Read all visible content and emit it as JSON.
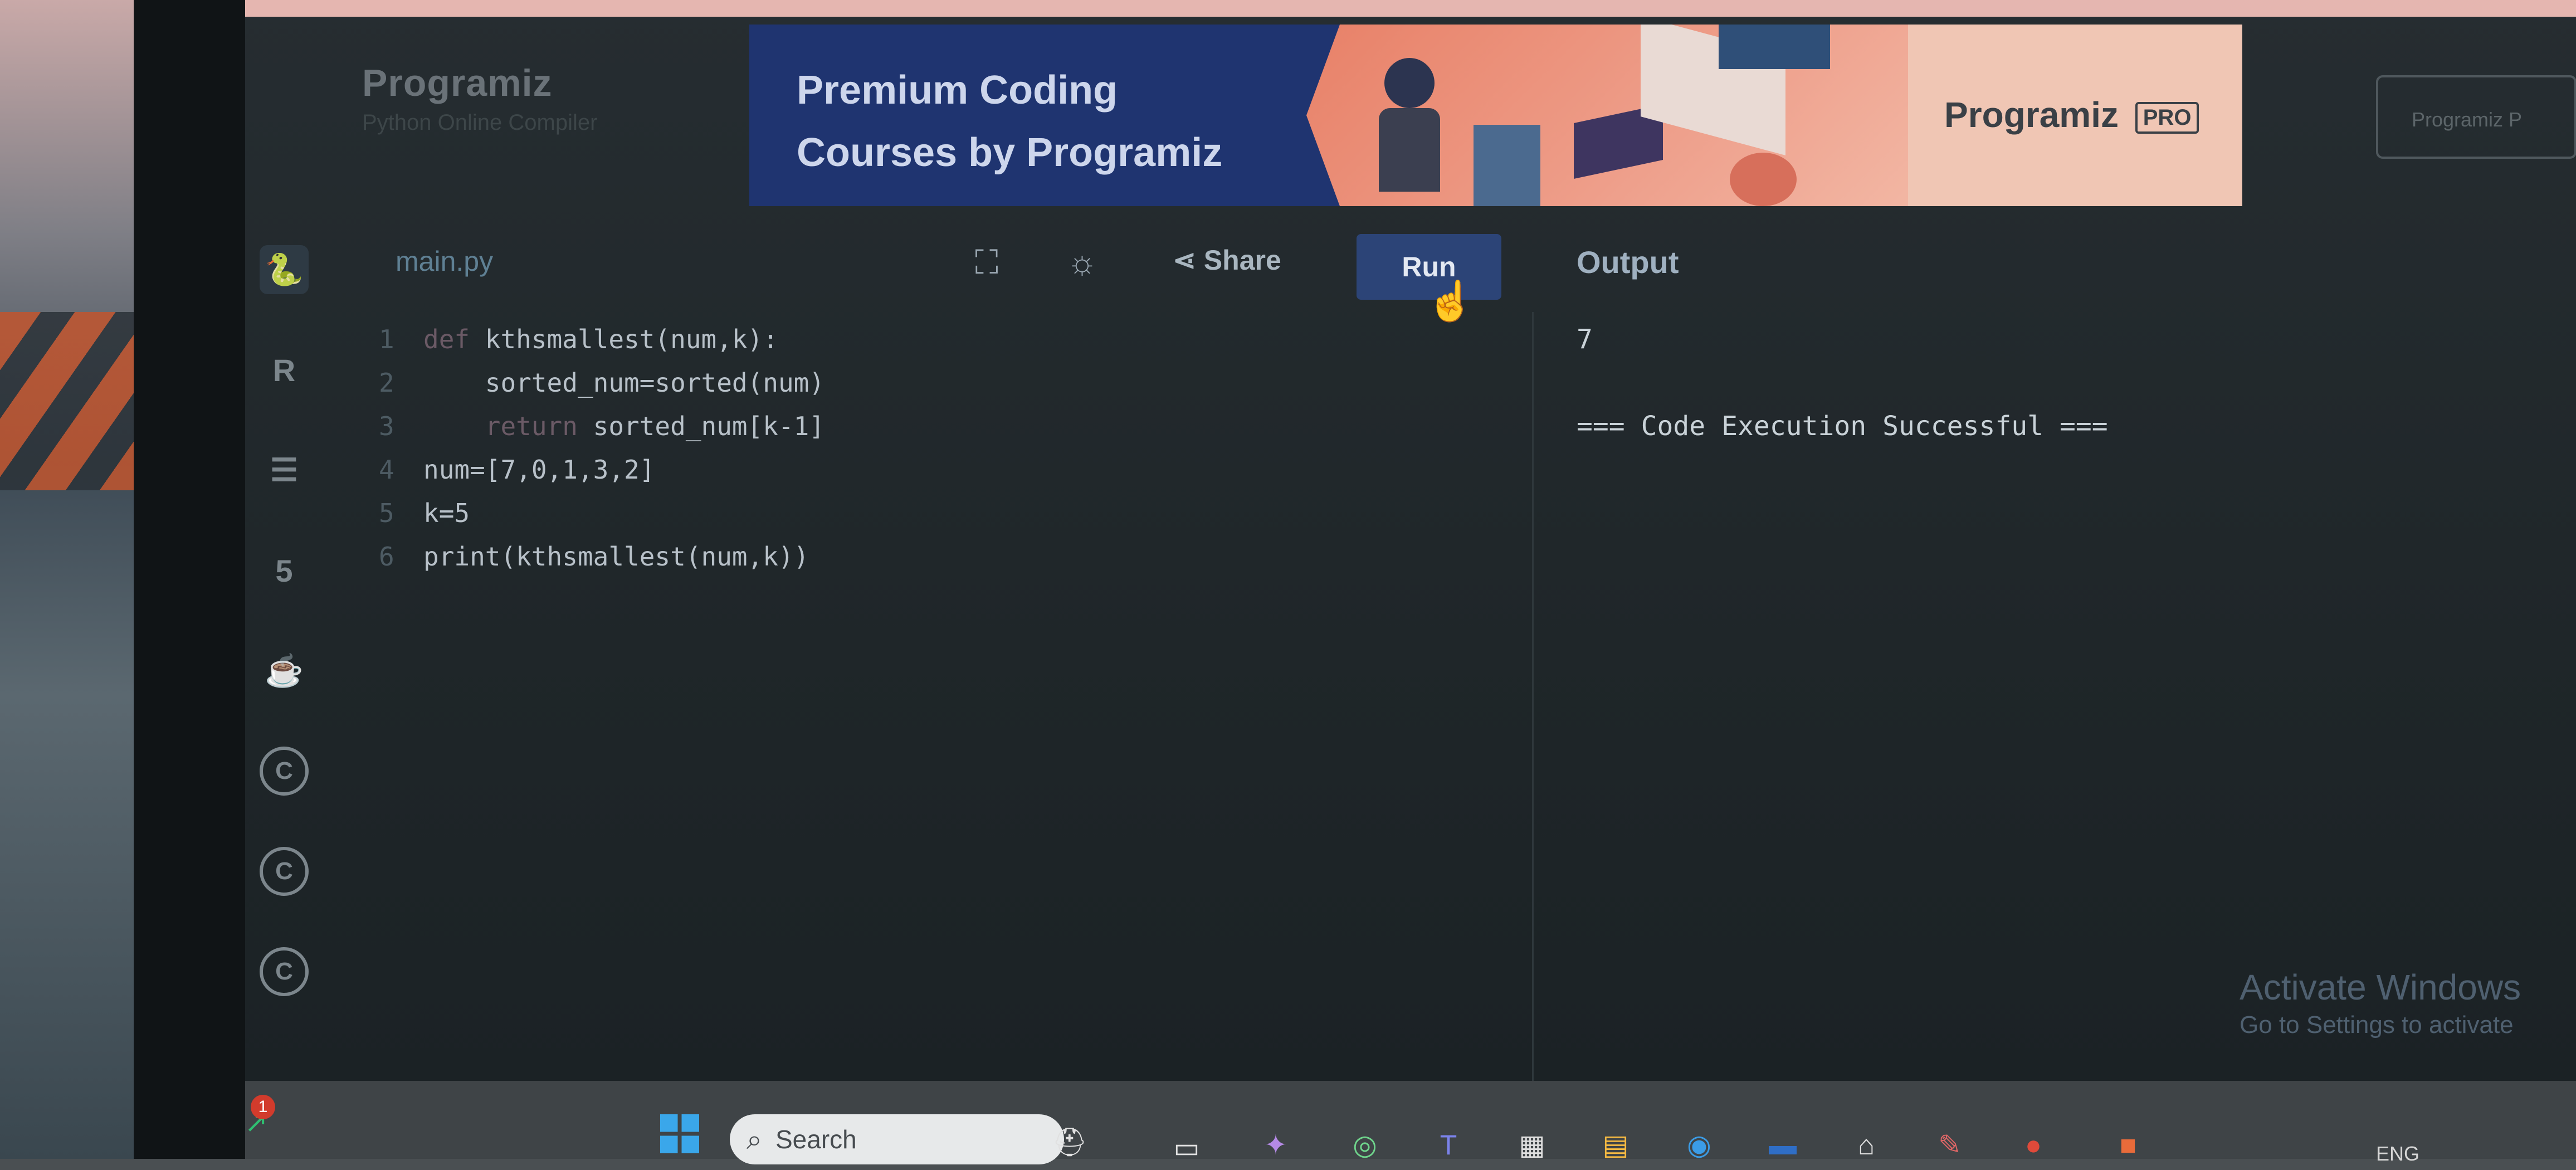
{
  "site": {
    "logo": "Programiz",
    "subtitle": "Python Online Compiler"
  },
  "banner": {
    "title_line1": "Premium Coding",
    "title_line2": "Courses by Programiz",
    "pro_logo": "Programiz",
    "pro_badge": "PRO"
  },
  "header_button": {
    "label": "Programiz P"
  },
  "sidebar": {
    "languages": [
      {
        "name": "python",
        "glyph": "🐍"
      },
      {
        "name": "r",
        "glyph": "R"
      },
      {
        "name": "sql",
        "glyph": "☰"
      },
      {
        "name": "html",
        "glyph": "5"
      },
      {
        "name": "java",
        "glyph": "☕"
      },
      {
        "name": "c",
        "glyph": "C"
      },
      {
        "name": "cpp",
        "glyph": "C"
      },
      {
        "name": "csharp",
        "glyph": "C"
      }
    ]
  },
  "editor": {
    "file_name": "main.py",
    "share_label": "Share",
    "run_label": "Run",
    "lines": [
      {
        "n": "1",
        "indent": "",
        "kw": "def",
        "rest": " kthsmallest(num,k):"
      },
      {
        "n": "2",
        "indent": "    ",
        "kw": "",
        "rest": "sorted_num=sorted(num)"
      },
      {
        "n": "3",
        "indent": "    ",
        "kw": "return",
        "rest": " sorted_num[k-1]"
      },
      {
        "n": "4",
        "indent": "",
        "kw": "",
        "rest": "num=[7,0,1,3,2]"
      },
      {
        "n": "5",
        "indent": "",
        "kw": "",
        "rest": "k=5"
      },
      {
        "n": "6",
        "indent": "",
        "kw": "",
        "rest": "print(kthsmallest(num,k))"
      }
    ]
  },
  "output": {
    "title": "Output",
    "result": "7",
    "status": "=== Code Execution Successful ==="
  },
  "watermark": {
    "title": "Activate Windows",
    "subtitle": "Go to Settings to activate"
  },
  "taskbar": {
    "search_placeholder": "Search",
    "notification_count": "1",
    "language": "ENG"
  }
}
